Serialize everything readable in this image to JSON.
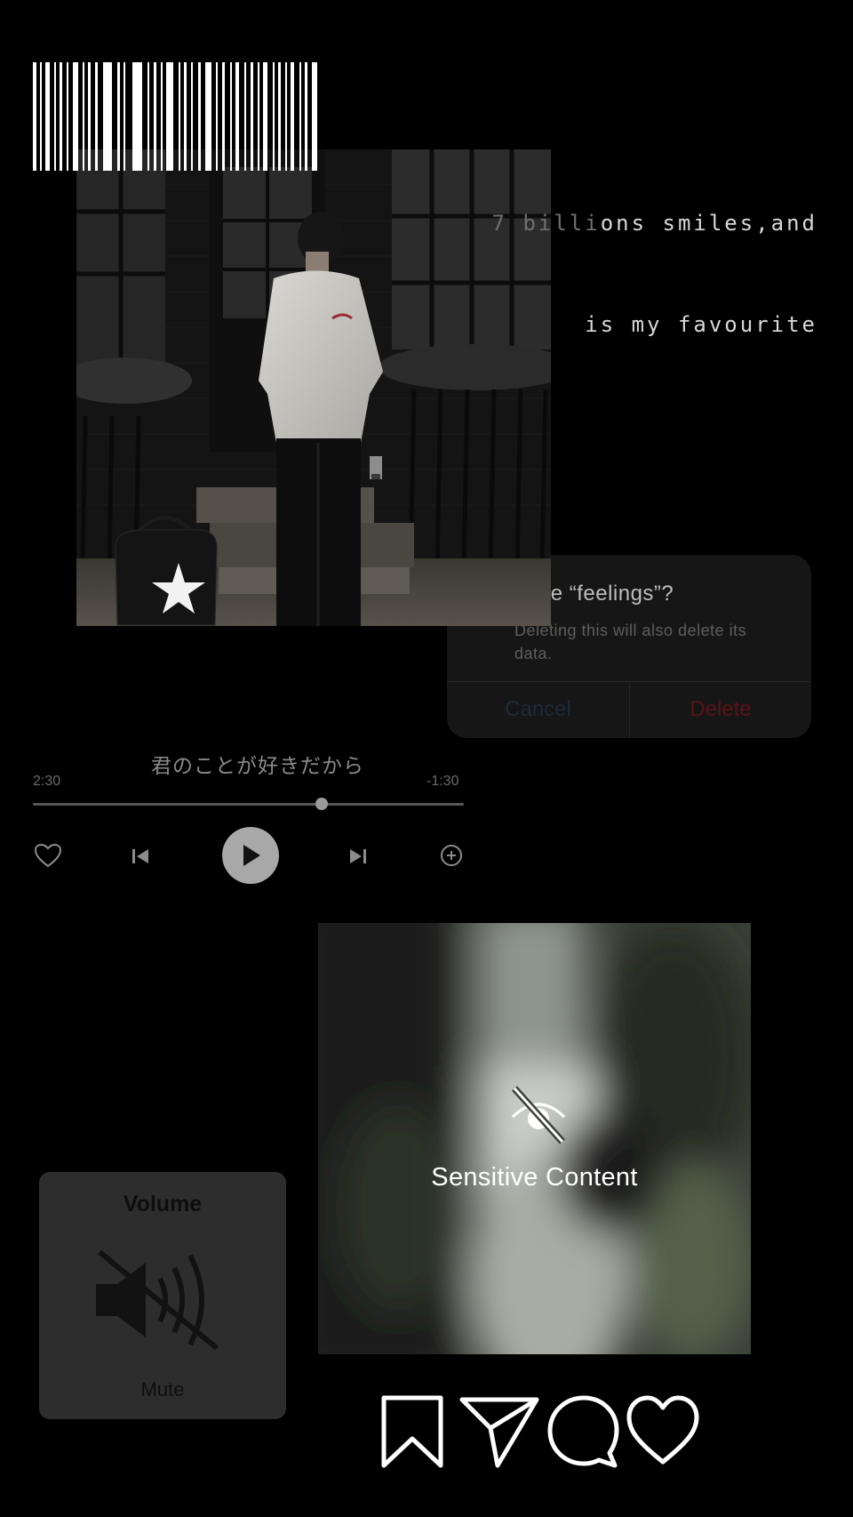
{
  "quote": {
    "line1_faded": "7 billi",
    "line1_text": "ons smiles,and",
    "line2_text": "is my favourite"
  },
  "alert": {
    "title": "elete “feelings”?",
    "message": "Deleting this will also delete its data.",
    "cancel_label": "Cancel",
    "delete_label": "Delete"
  },
  "player": {
    "song_title": "君のことが好きだから",
    "time_elapsed": "2:30",
    "time_remaining": "-1:30",
    "progress": 0.67
  },
  "sensitive": {
    "label": "Sensitive Content"
  },
  "volume": {
    "title": "Volume",
    "status": "Mute"
  },
  "icons": {
    "like": "heart-icon",
    "previous": "skip-back-icon",
    "play": "play-icon",
    "next": "skip-forward-icon",
    "add": "add-circle-icon",
    "hidden": "eye-slash-icon",
    "muted": "speaker-mute-icon",
    "bookmark": "bookmark-icon",
    "share": "send-icon",
    "comment": "comment-icon",
    "heart": "heart-outline-icon"
  },
  "colors": {
    "background": "#000000",
    "delete": "#5a1414",
    "cancel": "#1d2b3b"
  }
}
